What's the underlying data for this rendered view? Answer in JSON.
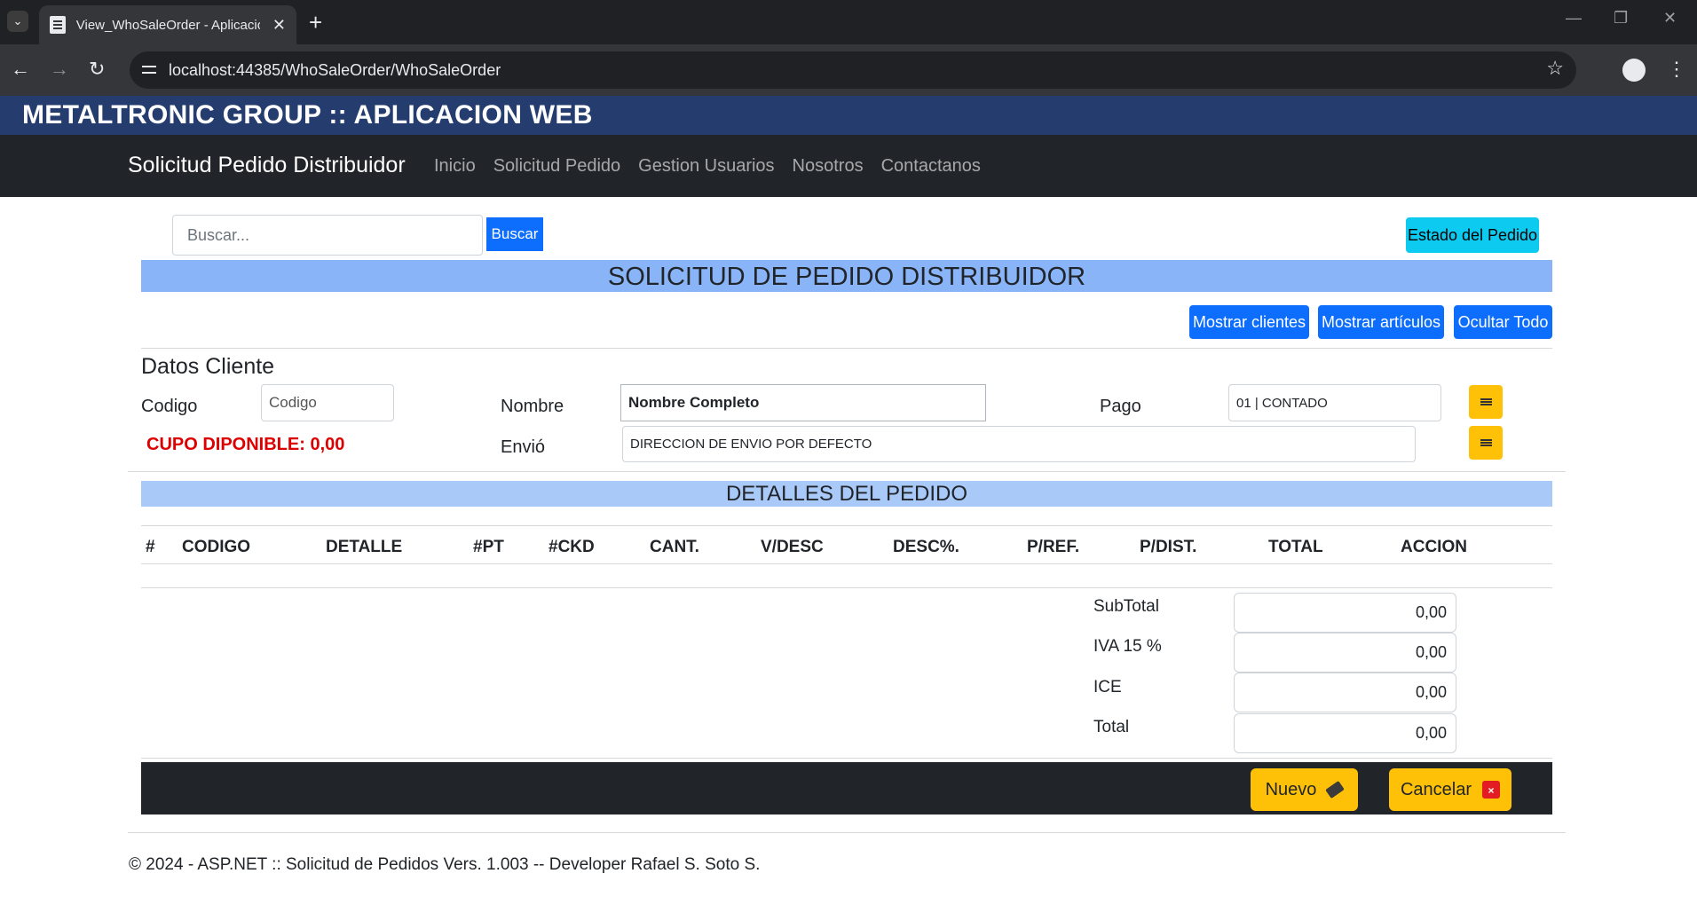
{
  "browser": {
    "tab_title": "View_WhoSaleOrder - Aplicacio",
    "url": "localhost:44385/WhoSaleOrder/WhoSaleOrder"
  },
  "app": {
    "brand": "METALTRONIC GROUP :: APLICACION WEB",
    "nav_brand": "Solicitud Pedido Distribuidor",
    "nav_links": [
      "Inicio",
      "Solicitud Pedido",
      "Gestion Usuarios",
      "Nosotros",
      "Contactanos"
    ]
  },
  "search": {
    "placeholder": "Buscar...",
    "button": "Buscar"
  },
  "status_button": "Estado del Pedido",
  "page_title": "SOLICITUD DE PEDIDO DISTRIBUIDOR",
  "toolbar": {
    "show_clients": "Mostrar clientes",
    "show_articles": "Mostrar artículos",
    "hide_all": "Ocultar Todo"
  },
  "client": {
    "section_title": "Datos Cliente",
    "code_label": "Codigo",
    "code_placeholder": "Codigo",
    "name_label": "Nombre",
    "name_value": "Nombre Completo",
    "payment_label": "Pago",
    "payment_value": "01 | CONTADO",
    "credit_text": "CUPO DIPONIBLE: 0,00",
    "shipping_label": "Envió",
    "shipping_value": "DIRECCION DE ENVIO POR DEFECTO"
  },
  "details": {
    "title": "DETALLES DEL PEDIDO",
    "columns": [
      "#",
      "CODIGO",
      "DETALLE",
      "#PT",
      "#CKD",
      "CANT.",
      "V/DESC",
      "DESC%.",
      "P/REF.",
      "P/DIST.",
      "TOTAL",
      "ACCION"
    ]
  },
  "totals": {
    "subtotal_label": "SubTotal",
    "subtotal_value": "0,00",
    "iva_label": "IVA 15 %",
    "iva_value": "0,00",
    "ice_label": "ICE",
    "ice_value": "0,00",
    "total_label": "Total",
    "total_value": "0,00"
  },
  "actions": {
    "new_label": "Nuevo",
    "cancel_label": "Cancelar"
  },
  "footer": "© 2024 - ASP.NET :: Solicitud de Pedidos Vers. 1.003 -- Developer Rafael S. Soto S.",
  "colors": {
    "brand_bar": "#243c6e",
    "navbar": "#212529",
    "band_title": "#8ab4f8",
    "band_details": "#a9c9f9",
    "primary": "#0d6efd",
    "info": "#0dcaf0",
    "warning": "#ffc107",
    "danger_text": "#dc0000"
  },
  "icons": {
    "tab_list": "chevron-down-icon",
    "favicon": "document-icon",
    "close": "close-icon",
    "new_tab": "plus-icon",
    "back": "arrow-left-icon",
    "forward": "arrow-right-icon",
    "reload": "reload-icon",
    "site_info": "tune-icon",
    "bookmark": "star-icon",
    "profile": "account-icon",
    "menu": "more-vert-icon",
    "list_picker": "table-icon",
    "eraser": "eraser-icon",
    "calendar_x": "calendar-x-icon"
  }
}
